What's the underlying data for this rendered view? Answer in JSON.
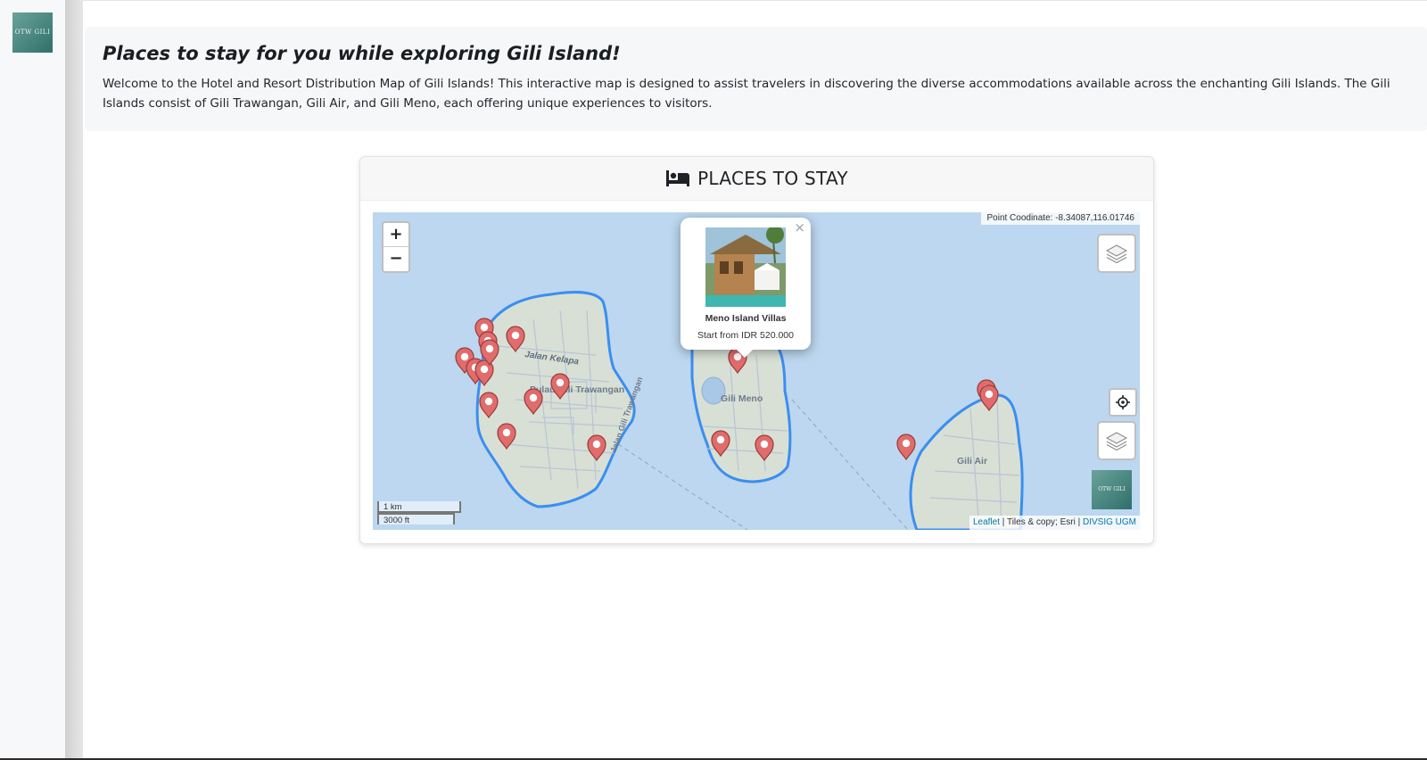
{
  "sidebar": {
    "logo_text": "OTW GILI"
  },
  "hero": {
    "title": "Places to stay for you while exploring Gili Island!",
    "description": "Welcome to the Hotel and Resort Distribution Map of Gili Islands! This interactive map is designed to assist travelers in discovering the diverse accommodations available across the enchanting Gili Islands. The Gili Islands consist of Gili Trawangan, Gili Air, and Gili Meno, each offering unique experiences to visitors."
  },
  "card": {
    "title": "PLACES TO STAY",
    "icon": "bed-icon"
  },
  "map": {
    "zoom_in": "+",
    "zoom_out": "−",
    "coordinate_label": "Point Coodinate: -8.34087,116.01746",
    "scale_km": "1 km",
    "scale_ft": "3000 ft",
    "attribution": {
      "leaflet": "Leaflet",
      "tiles": " | Tiles & copy; Esri | ",
      "divsig": "DIVSIG UGM"
    },
    "island_labels": {
      "trawangan_road": "Jalan Kelapa",
      "trawangan": "Pulau Gili Trawangan",
      "trawangan_coast": "Jalan Gili Trawangan",
      "meno": "Gili Meno",
      "air": "Gili Air"
    },
    "mini_logo_text": "OTW GILI",
    "colors": {
      "water": "#bcd7ef",
      "land": "#d7dfd3",
      "coast": "#3b8ef0",
      "pin": "#e06c6c"
    },
    "popup": {
      "name": "Meno Island Villas",
      "price": "Start from IDR 520.000",
      "close": "×"
    }
  }
}
